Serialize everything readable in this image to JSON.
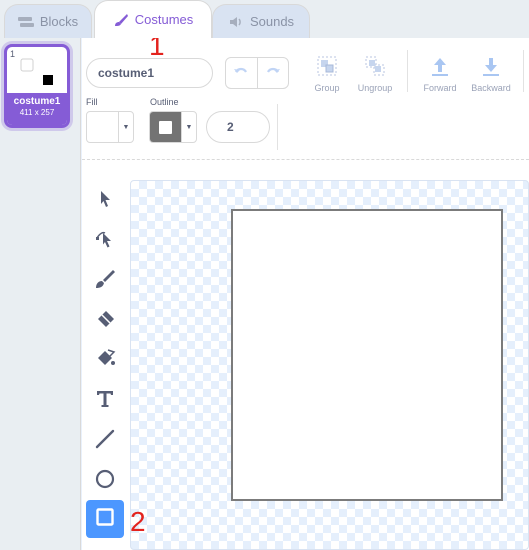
{
  "tabs": [
    {
      "label": "Blocks",
      "icon": "blocks-icon"
    },
    {
      "label": "Costumes",
      "icon": "paintbrush-icon",
      "active": true
    },
    {
      "label": "Sounds",
      "icon": "speaker-icon"
    }
  ],
  "costume": {
    "number": "1",
    "name": "costume1",
    "dimensions": "411 x 257"
  },
  "toolbar": {
    "costume_name": "costume1",
    "group_label": "Group",
    "ungroup_label": "Ungroup",
    "forward_label": "Forward",
    "backward_label": "Backward"
  },
  "fill": {
    "label": "Fill",
    "color": "#ffffff"
  },
  "outline": {
    "label": "Outline",
    "color": "#737373",
    "width": "2"
  },
  "tools": [
    "select",
    "reshape",
    "brush",
    "eraser",
    "fill",
    "text",
    "line",
    "circle",
    "rectangle"
  ],
  "active_tool": "rectangle",
  "annotations": {
    "marker1": "1",
    "marker2": "2"
  },
  "colors": {
    "accent": "#855cd6",
    "active_tool": "#4c97ff",
    "marker": "#e3231e"
  }
}
